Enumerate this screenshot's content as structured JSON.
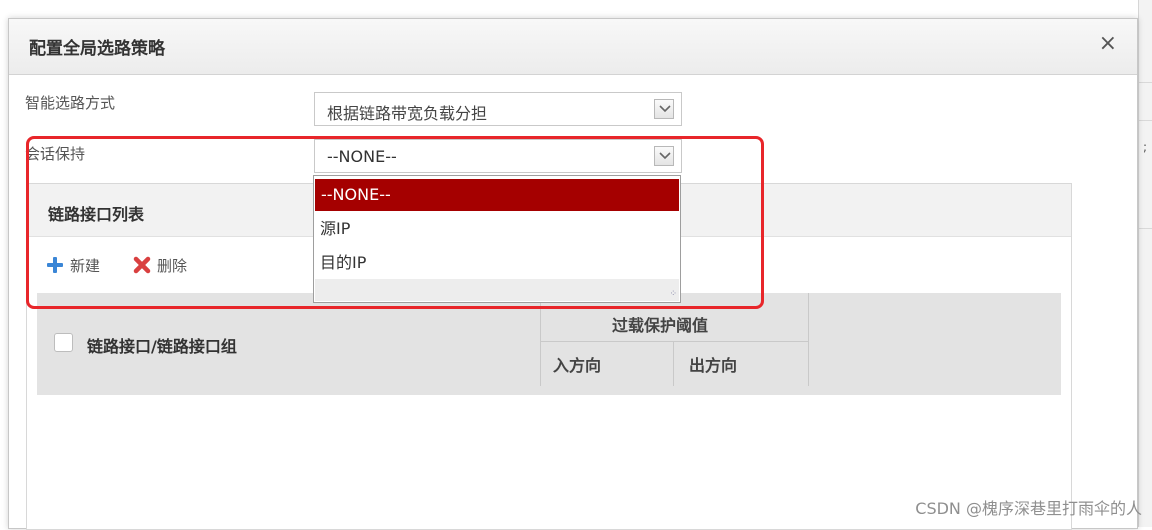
{
  "dialog": {
    "title": "配置全局选路策略",
    "close_glyph": "×"
  },
  "form": {
    "routing_mode": {
      "label": "智能选路方式",
      "value": "根据链路带宽负载分担"
    },
    "session_persistence": {
      "label": "会话保持",
      "value": "--NONE--",
      "options": [
        "--NONE--",
        "源IP",
        "目的IP"
      ],
      "selected_index": 0
    }
  },
  "panel": {
    "title": "链路接口列表",
    "toolbar": {
      "new_label": "新建",
      "delete_label": "删除"
    },
    "grid": {
      "column_main": "链路接口/链路接口组",
      "column_group": "过载保护阈值",
      "column_in": "入方向",
      "column_out": "出方向"
    }
  },
  "colors": {
    "selected_option": "#a50000",
    "highlight_box": "#e8262a",
    "add_icon": "#3a86d6",
    "delete_icon": "#d94040"
  },
  "watermark": "CSDN @槐序深巷里打雨伞的人"
}
